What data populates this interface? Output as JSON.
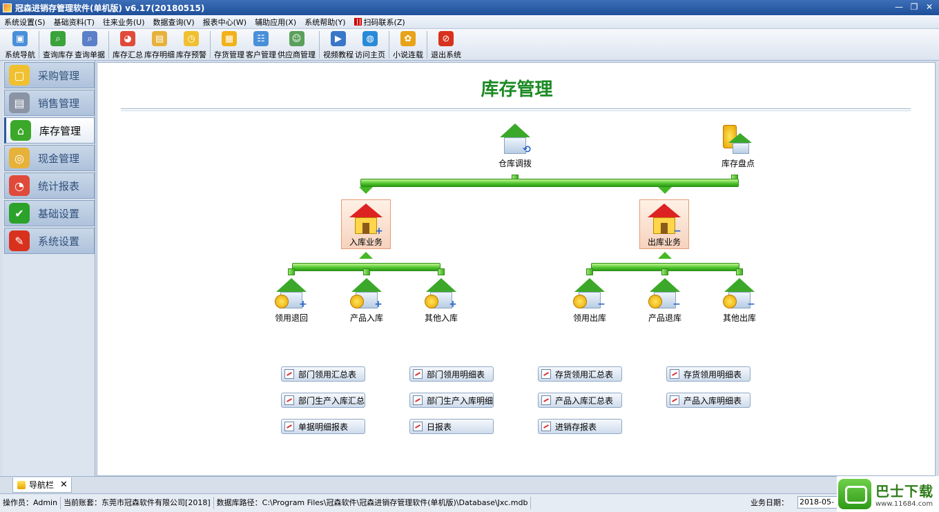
{
  "window": {
    "title": "冠森进销存管理软件(单机版) v6.17(20180515)",
    "min": "—",
    "restore": "❐",
    "close": "✕"
  },
  "menu": [
    "系统设置(S)",
    "基础资料(T)",
    "往来业务(U)",
    "数据查询(V)",
    "报表中心(W)",
    "辅助应用(X)",
    "系统帮助(Y)",
    "扫码联系(Z)"
  ],
  "toolbar": [
    {
      "label": "系统导航",
      "icon": "computer-icon",
      "color": "#4a8fd8",
      "glyph": "▣"
    },
    {
      "label": "查询库存",
      "icon": "search-house-icon",
      "color": "#3aa33a",
      "glyph": "⌕"
    },
    {
      "label": "查询单据",
      "icon": "search-doc-icon",
      "color": "#5b7fc8",
      "glyph": "⌕"
    },
    {
      "label": "库存汇总",
      "icon": "summary-icon",
      "color": "#e04a3a",
      "glyph": "◕"
    },
    {
      "label": "库存明细",
      "icon": "detail-icon",
      "color": "#e7b23a",
      "glyph": "▤"
    },
    {
      "label": "库存预警",
      "icon": "warning-icon",
      "color": "#f0c030",
      "glyph": "◷"
    },
    {
      "label": "存货管理",
      "icon": "box-icon",
      "color": "#f2b21a",
      "glyph": "▦"
    },
    {
      "label": "客户管理",
      "icon": "customer-icon",
      "color": "#4a8fd8",
      "glyph": "☷"
    },
    {
      "label": "供应商管理",
      "icon": "supplier-icon",
      "color": "#5aa05a",
      "glyph": "☺"
    },
    {
      "label": "视频教程",
      "icon": "video-icon",
      "color": "#3a76c8",
      "glyph": "▶"
    },
    {
      "label": "访问主页",
      "icon": "globe-icon",
      "color": "#2a8ad8",
      "glyph": "◍"
    },
    {
      "label": "小说连载",
      "icon": "flower-icon",
      "color": "#e7a31a",
      "glyph": "✿"
    },
    {
      "label": "退出系统",
      "icon": "exit-icon",
      "color": "#d8321e",
      "glyph": "⊘"
    }
  ],
  "sidebar": [
    {
      "label": "采购管理",
      "icon": "purchase-icon",
      "color": "#f0c030",
      "glyph": "▢"
    },
    {
      "label": "销售管理",
      "icon": "sales-icon",
      "color": "#8a94a4",
      "glyph": "▤"
    },
    {
      "label": "库存管理",
      "icon": "inventory-icon",
      "color": "#3ca82a",
      "glyph": "⌂",
      "active": true
    },
    {
      "label": "现金管理",
      "icon": "cash-icon",
      "color": "#e7b23a",
      "glyph": "◎"
    },
    {
      "label": "统计报表",
      "icon": "report-icon",
      "color": "#e04a3a",
      "glyph": "◔"
    },
    {
      "label": "基础设置",
      "icon": "check-icon",
      "color": "#2ca22a",
      "glyph": "✔"
    },
    {
      "label": "系统设置",
      "icon": "wrench-icon",
      "color": "#d8321e",
      "glyph": "✎"
    }
  ],
  "main": {
    "title": "库存管理",
    "top_nodes": [
      "仓库调拨",
      "库存盘点"
    ],
    "in_node": "入库业务",
    "out_node": "出库业务",
    "in_children": [
      "领用退回",
      "产品入库",
      "其他入库"
    ],
    "out_children": [
      "领用出库",
      "产品退库",
      "其他出库"
    ],
    "reports": [
      [
        "部门领用汇总表",
        "部门领用明细表",
        "存货领用汇总表",
        "存货领用明细表"
      ],
      [
        "部门生产入库汇总",
        "部门生产入库明细",
        "产品入库汇总表",
        "产品入库明细表"
      ],
      [
        "单据明细报表",
        "日报表",
        "进销存报表"
      ]
    ]
  },
  "tab": {
    "label": "导航栏",
    "close": "✕"
  },
  "status": {
    "operator": "操作员：Admin",
    "account": "当前账套：东莞市冠森软件有限公司[2018]",
    "dbpath": "数据库路径：C:\\Program Files\\冠森软件\\冠森进销存管理软件(单机版)\\Database\\Jxc.mdb",
    "date_label": "业务日期：",
    "date_value": "2018-05-17"
  },
  "watermark": {
    "text": "巴士下载",
    "url": "www.11684.com"
  }
}
